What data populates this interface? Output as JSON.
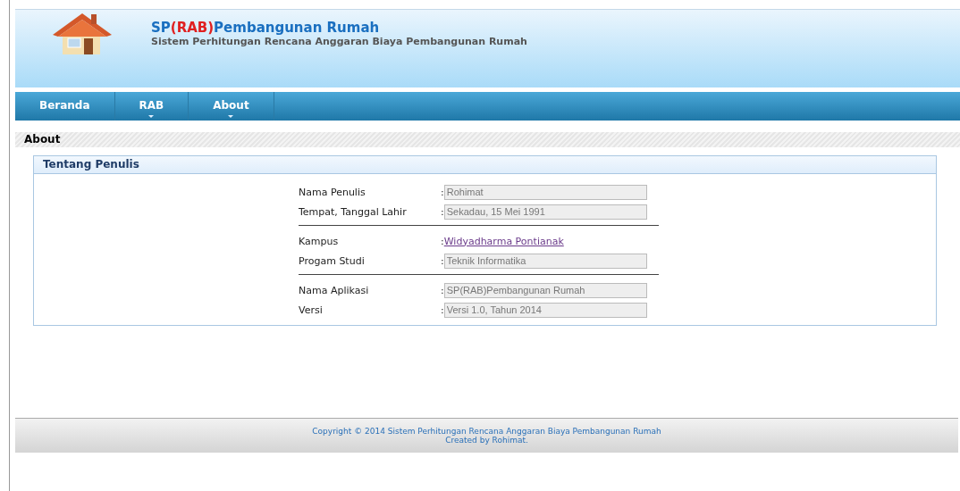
{
  "header": {
    "title_start": "SP",
    "title_mark": "(RAB)",
    "title_end": "Pembangunan Rumah",
    "subtitle": "Sistem Perhitungan Rencana Anggaran Biaya Pembangunan Rumah"
  },
  "nav": [
    {
      "label": "Beranda",
      "has_dropdown": false
    },
    {
      "label": "RAB",
      "has_dropdown": true
    },
    {
      "label": "About",
      "has_dropdown": true
    }
  ],
  "page_title": "About",
  "panel": {
    "title": "Tentang Penulis",
    "groups": [
      [
        {
          "kind": "field",
          "label": "Nama Penulis",
          "separator": ":",
          "value": "Rohimat"
        },
        {
          "kind": "field",
          "label": "Tempat, Tanggal Lahir",
          "separator": ":",
          "value": "Sekadau, 15 Mei 1991"
        }
      ],
      [
        {
          "kind": "link",
          "label": "Kampus",
          "separator": ":",
          "value": " Widyadharma Pontianak"
        },
        {
          "kind": "field",
          "label": "Progam Studi",
          "separator": ":",
          "value": "Teknik Informatika"
        }
      ],
      [
        {
          "kind": "field",
          "label": "Nama Aplikasi",
          "separator": ":",
          "value": "SP(RAB)Pembangunan Rumah"
        },
        {
          "kind": "field",
          "label": "Versi",
          "separator": ":",
          "value": "Versi 1.0, Tahun 2014"
        }
      ]
    ]
  },
  "footer": [
    "Copyright © 2014 Sistem Perhitungan Rencana Anggaran Biaya Pembangunan Rumah",
    "Created by Rohimat."
  ]
}
